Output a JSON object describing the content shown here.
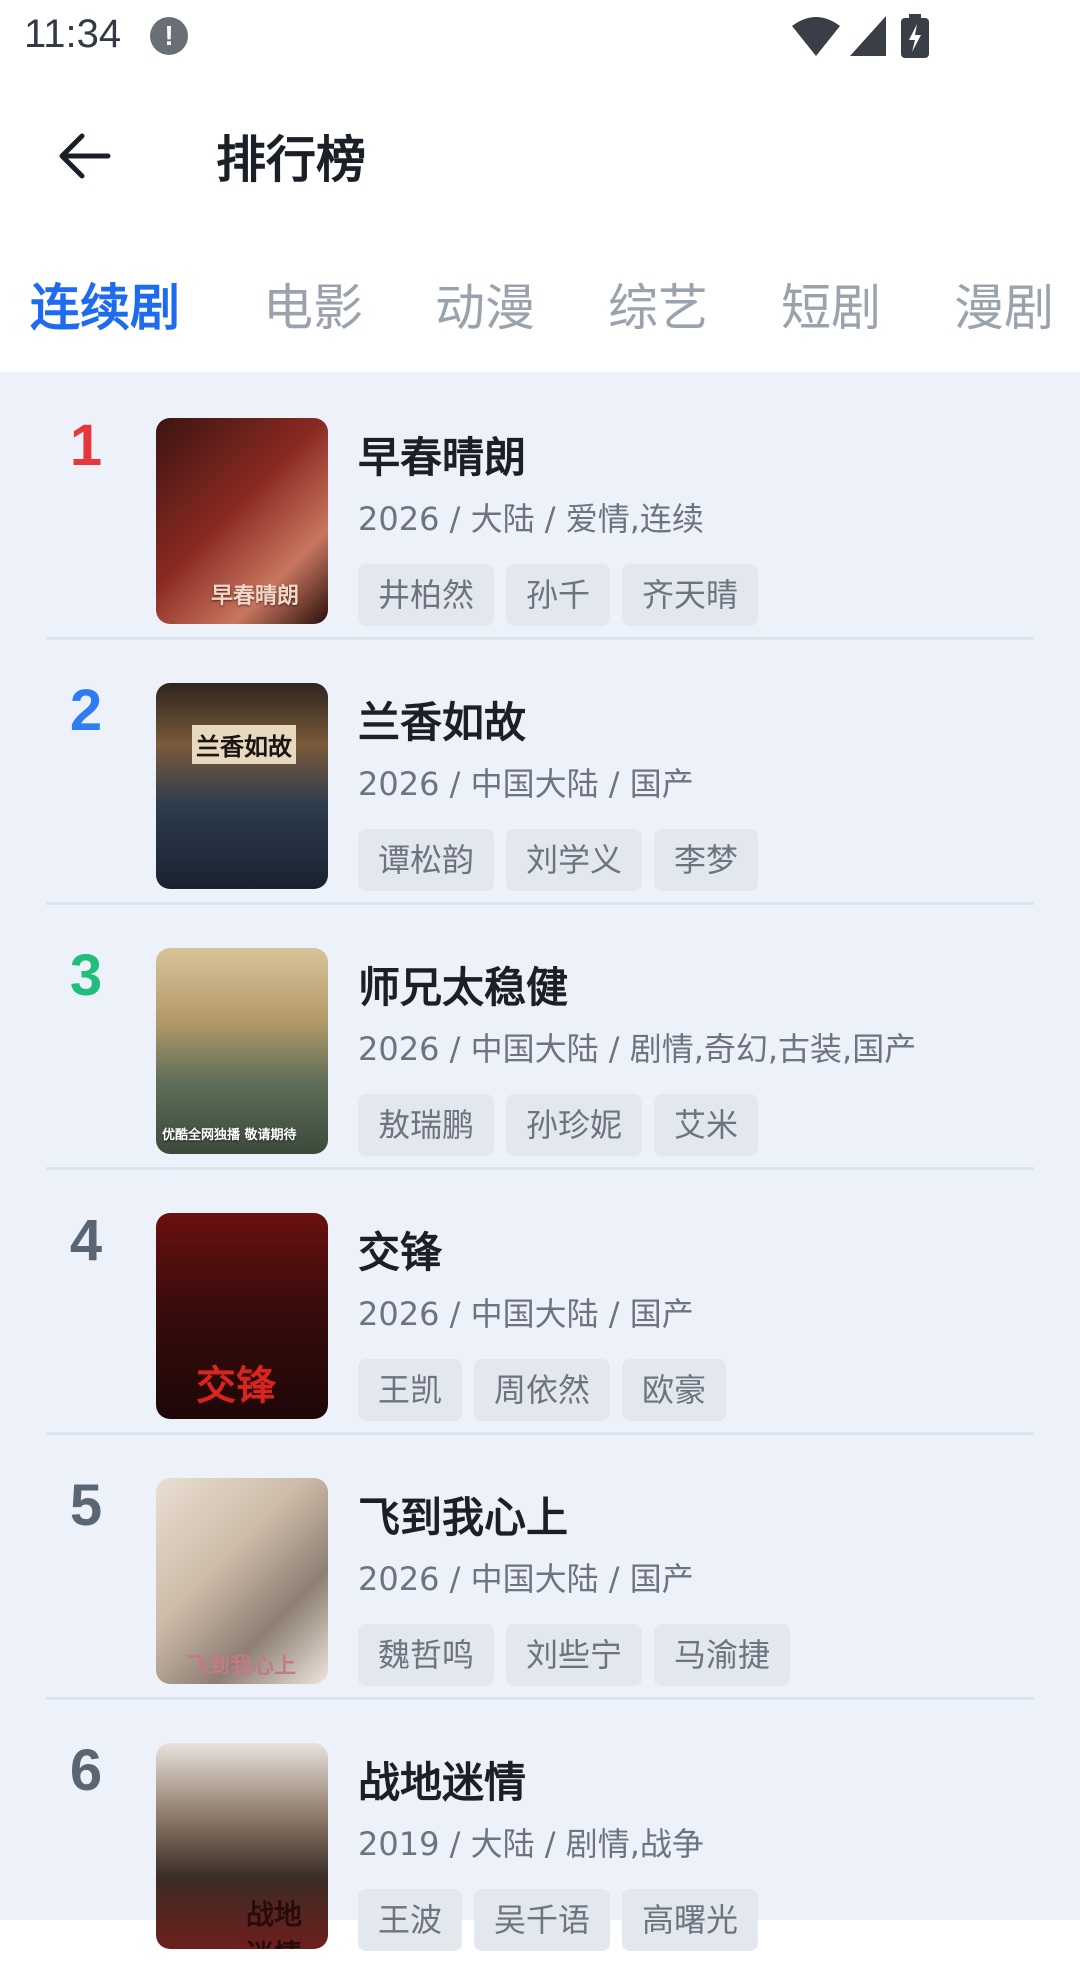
{
  "status_bar": {
    "time": "11:34",
    "alert_glyph": "!"
  },
  "header": {
    "title": "排行榜"
  },
  "tabs": [
    {
      "label": "连续剧",
      "active": true
    },
    {
      "label": "电影",
      "active": false
    },
    {
      "label": "动漫",
      "active": false
    },
    {
      "label": "综艺",
      "active": false
    },
    {
      "label": "短剧",
      "active": false
    },
    {
      "label": "漫剧",
      "active": false
    }
  ],
  "colors": {
    "accent": "#1e6bf0",
    "rank_1": "#e5383b",
    "rank_2": "#2f7bf2",
    "rank_3": "#1fbe7a",
    "rank_other": "#5b6675"
  },
  "items": [
    {
      "rank": "1",
      "title": "早春晴朗",
      "meta": "2026 / 大陆 / 爱情,连续",
      "tags": [
        "井柏然",
        "孙千",
        "齐天晴"
      ],
      "poster_caption": "早春晴朗"
    },
    {
      "rank": "2",
      "title": "兰香如故",
      "meta": "2026 / 中国大陆 / 国产",
      "tags": [
        "谭松韵",
        "刘学义",
        "李梦"
      ],
      "poster_caption": "兰香如故"
    },
    {
      "rank": "3",
      "title": "师兄太稳健",
      "meta": "2026 / 中国大陆 / 剧情,奇幻,古装,国产",
      "tags": [
        "敖瑞鹏",
        "孙珍妮",
        "艾米"
      ],
      "poster_caption": "优酷全网独播 敬请期待"
    },
    {
      "rank": "4",
      "title": "交锋",
      "meta": "2026 / 中国大陆 / 国产",
      "tags": [
        "王凯",
        "周依然",
        "欧豪"
      ],
      "poster_caption": "交锋"
    },
    {
      "rank": "5",
      "title": "飞到我心上",
      "meta": "2026 / 中国大陆 / 国产",
      "tags": [
        "魏哲鸣",
        "刘些宁",
        "马渝捷"
      ],
      "poster_caption": "飞到我心上"
    },
    {
      "rank": "6",
      "title": "战地迷情",
      "meta": "2019 / 大陆 / 剧情,战争",
      "tags": [
        "王波",
        "吴千语",
        "高曙光"
      ],
      "poster_caption": "战地迷情"
    }
  ]
}
